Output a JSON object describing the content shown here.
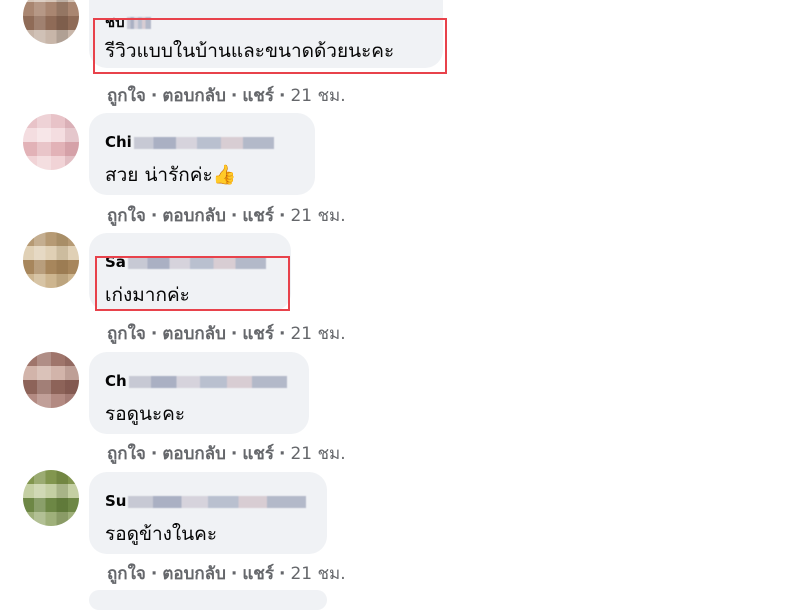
{
  "comments": [
    {
      "author": "ชบ",
      "text": "รีวิวแบบในบ้านและขนาดด้วยนะคะ",
      "actions": {
        "like": "ถูกใจ",
        "reply": "ตอบกลับ",
        "share": "แชร์",
        "time": "21 ชม."
      }
    },
    {
      "author": "Chi",
      "text": "สวย น่ารักค่ะ",
      "emoji": "👍",
      "actions": {
        "like": "ถูกใจ",
        "reply": "ตอบกลับ",
        "share": "แชร์",
        "time": "21 ชม."
      }
    },
    {
      "author": "Sa",
      "text": "เก่งมากค่ะ",
      "actions": {
        "like": "ถูกใจ",
        "reply": "ตอบกลับ",
        "share": "แชร์",
        "time": "21 ชม."
      }
    },
    {
      "author": "Ch",
      "text": "รอดูนะคะ",
      "actions": {
        "like": "ถูกใจ",
        "reply": "ตอบกลับ",
        "share": "แชร์",
        "time": "21 ชม."
      }
    },
    {
      "author": "Su",
      "text": "รอดูข้างในคะ",
      "actions": {
        "like": "ถูกใจ",
        "reply": "ตอบกลับ",
        "share": "แชร์",
        "time": "21 ชม."
      }
    }
  ],
  "colors": {
    "bubble_bg": "#f0f2f5",
    "action_text": "#65676b",
    "highlight_border": "#e8424b"
  }
}
